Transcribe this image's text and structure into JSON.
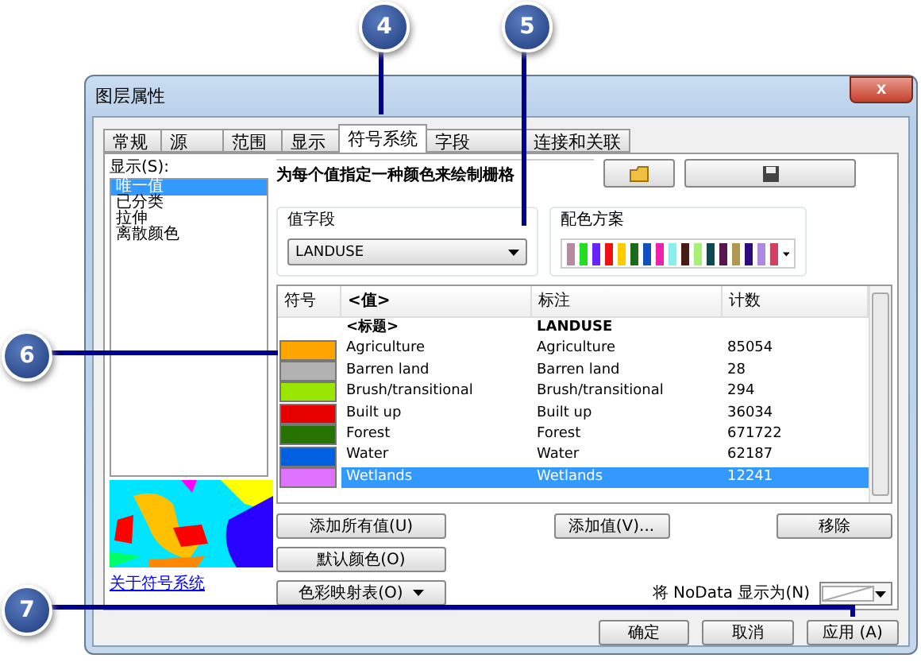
{
  "callouts": [
    {
      "label": "4"
    },
    {
      "label": "5"
    },
    {
      "label": "6"
    },
    {
      "label": "7"
    }
  ],
  "window": {
    "title": "图层属性",
    "close": "x"
  },
  "tabs": [
    {
      "label": "常规",
      "selected": false
    },
    {
      "label": "源",
      "selected": false
    },
    {
      "label": "范围",
      "selected": false
    },
    {
      "label": "显示",
      "selected": false
    },
    {
      "label": "符号系统",
      "selected": true
    },
    {
      "label": "字段",
      "selected": false
    },
    {
      "label": "连接和关联",
      "selected": false
    }
  ],
  "show": {
    "label": "显示(S):",
    "items": [
      {
        "label": "唯一值",
        "selected": true
      },
      {
        "label": "已分类",
        "selected": false
      },
      {
        "label": "拉伸",
        "selected": false
      },
      {
        "label": "离散颜色",
        "selected": false
      }
    ]
  },
  "about_link": "关于符号系统",
  "heading": "为每个值指定一种颜色来绘制栅格",
  "value_field": {
    "label": "值字段",
    "value": "LANDUSE"
  },
  "color_scheme": {
    "label": "配色方案",
    "swatches": [
      {
        "color": "#b48aa0"
      },
      {
        "color": "#22dd22"
      },
      {
        "color": "#6622ff"
      },
      {
        "color": "#ee1111"
      },
      {
        "color": "#ffcc00"
      },
      {
        "color": "#1c6b1c"
      },
      {
        "color": "#1050c0"
      },
      {
        "color": "#ee22aa"
      },
      {
        "color": "#88eeee"
      },
      {
        "color": "#4a1a14"
      },
      {
        "color": "#aaee77"
      },
      {
        "color": "#104850"
      },
      {
        "color": "#5a1450"
      },
      {
        "color": "#b09850"
      },
      {
        "color": "#2c0c80"
      },
      {
        "color": "#b088e0"
      },
      {
        "color": "#d04060"
      }
    ]
  },
  "table": {
    "columns": [
      "符号",
      "<值>",
      "标注",
      "计数"
    ],
    "heading_row": {
      "value": "<标题>",
      "label": "LANDUSE"
    },
    "rows": [
      {
        "color": "#ffa500",
        "value": "Agriculture",
        "label": "Agriculture",
        "count": "85054",
        "selected": false
      },
      {
        "color": "#b2b2b2",
        "value": "Barren land",
        "label": "Barren land",
        "count": "28",
        "selected": false
      },
      {
        "color": "#99e600",
        "value": "Brush/transitional",
        "label": "Brush/transitional",
        "count": "294",
        "selected": false
      },
      {
        "color": "#e60000",
        "value": "Built up",
        "label": "Built up",
        "count": "36034",
        "selected": false
      },
      {
        "color": "#267300",
        "value": "Forest",
        "label": "Forest",
        "count": "671722",
        "selected": false
      },
      {
        "color": "#0060e0",
        "value": "Water",
        "label": "Water",
        "count": "62187",
        "selected": false
      },
      {
        "color": "#df73ff",
        "value": "Wetlands",
        "label": "Wetlands",
        "count": "12241",
        "selected": true
      }
    ]
  },
  "buttons": {
    "add_all": "添加所有值(U)",
    "add": "添加值(V)...",
    "remove": "移除",
    "default_colors": "默认颜色(O)",
    "colormap": "色彩映射表(O)"
  },
  "nodata_label": "将 NoData 显示为(N)",
  "dialog_buttons": [
    "确定",
    "取消",
    "应用 (A)"
  ]
}
